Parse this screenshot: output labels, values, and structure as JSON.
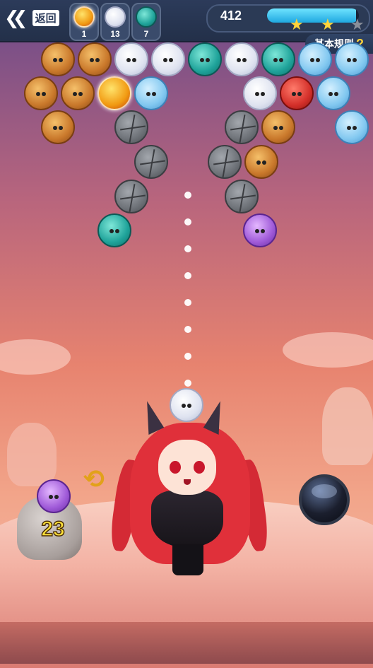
{
  "header": {
    "back_label": "返回",
    "targets": [
      {
        "icon": "gold-swirl-bubble-icon",
        "count": "1"
      },
      {
        "icon": "white-unicorn-bubble-icon",
        "count": "13"
      },
      {
        "icon": "teal-dragon-bubble-icon",
        "count": "7"
      }
    ],
    "score": "412",
    "progress": 0.97,
    "stars_earned": 2,
    "stars_total": 3,
    "rules_label": "基本规则",
    "rules_icon": "?"
  },
  "board": {
    "bubbles": [
      {
        "type": "brown",
        "name": "hedgehog-bubble"
      },
      {
        "type": "brown",
        "name": "hedgehog-bubble"
      },
      {
        "type": "white",
        "name": "unicorn-bubble"
      },
      {
        "type": "white",
        "name": "unicorn-bubble"
      },
      {
        "type": "teal",
        "name": "dragon-bubble"
      },
      {
        "type": "white",
        "name": "unicorn-bubble"
      },
      {
        "type": "teal",
        "name": "dragon-bubble"
      },
      {
        "type": "blue",
        "name": "unicorn-blue-bubble"
      },
      {
        "type": "blue",
        "name": "unicorn-blue-bubble"
      },
      {
        "type": "brown",
        "name": "hedgehog-bubble"
      },
      {
        "type": "brown",
        "name": "hedgehog-bubble"
      },
      {
        "type": "gold",
        "name": "gold-swirl-bubble"
      },
      {
        "type": "blue",
        "name": "unicorn-blue-bubble"
      },
      {
        "type": "white",
        "name": "unicorn-bubble"
      },
      {
        "type": "red",
        "name": "red-monster-bubble"
      },
      {
        "type": "blue",
        "name": "unicorn-blue-bubble"
      },
      {
        "type": "brown",
        "name": "hedgehog-bubble"
      },
      {
        "type": "stone",
        "name": "stone-bubble"
      },
      {
        "type": "stone",
        "name": "stone-bubble"
      },
      {
        "type": "brown",
        "name": "hedgehog-bubble"
      },
      {
        "type": "blue",
        "name": "unicorn-blue-bubble"
      },
      {
        "type": "stone",
        "name": "stone-bubble"
      },
      {
        "type": "stone",
        "name": "stone-bubble"
      },
      {
        "type": "brown",
        "name": "hedgehog-bubble"
      },
      {
        "type": "stone",
        "name": "stone-bubble"
      },
      {
        "type": "stone",
        "name": "stone-bubble"
      },
      {
        "type": "teal",
        "name": "dragon-bubble"
      },
      {
        "type": "purple",
        "name": "purple-monster-bubble"
      }
    ]
  },
  "shooter": {
    "current_bubble": {
      "type": "white",
      "name": "unicorn-bubble"
    },
    "next_bubble": {
      "type": "purple",
      "name": "purple-monster-bubble"
    },
    "bubbles_left": "23",
    "swap_icon": "swap-arrows-icon",
    "bomb_icon": "bomb-bubble-icon"
  },
  "colors": {
    "accent": "#1fa8e0",
    "star": "#ffd43b",
    "count": "#ffe23b"
  }
}
